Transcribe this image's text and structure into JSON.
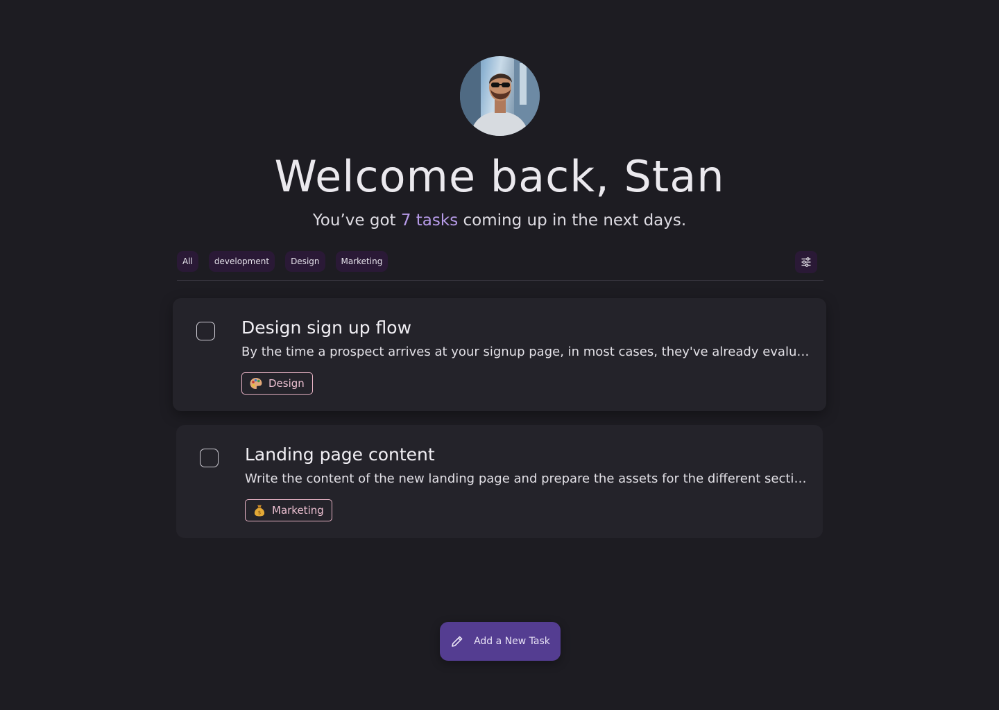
{
  "header": {
    "title": "Welcome back, Stan",
    "subtitle_prefix": "You’ve got ",
    "subtitle_highlight": "7 tasks",
    "subtitle_suffix": " coming up in the next days."
  },
  "filters": [
    {
      "label": "All"
    },
    {
      "label": "development"
    },
    {
      "label": "Design"
    },
    {
      "label": "Marketing"
    }
  ],
  "tasks": [
    {
      "title": "Design sign up flow",
      "description": "By the time a prospect arrives at your signup page, in most cases, they've already evaluated your product and decided to sign up.",
      "tag": "Design",
      "tag_icon": "palette-icon"
    },
    {
      "title": "Landing page content",
      "description": "Write the content of the new landing page and prepare the assets for the different sections of the page.",
      "tag": "Marketing",
      "tag_icon": "money-bag-icon"
    }
  ],
  "add_button": {
    "label": "Add a New Task",
    "icon": "pencil-icon"
  },
  "colors": {
    "background": "#1d1c22",
    "card": "#24232a",
    "chip": "#2a1936",
    "accent": "#b79be9",
    "primary_button": "#543d91",
    "tag_border": "#e9b4c6"
  }
}
